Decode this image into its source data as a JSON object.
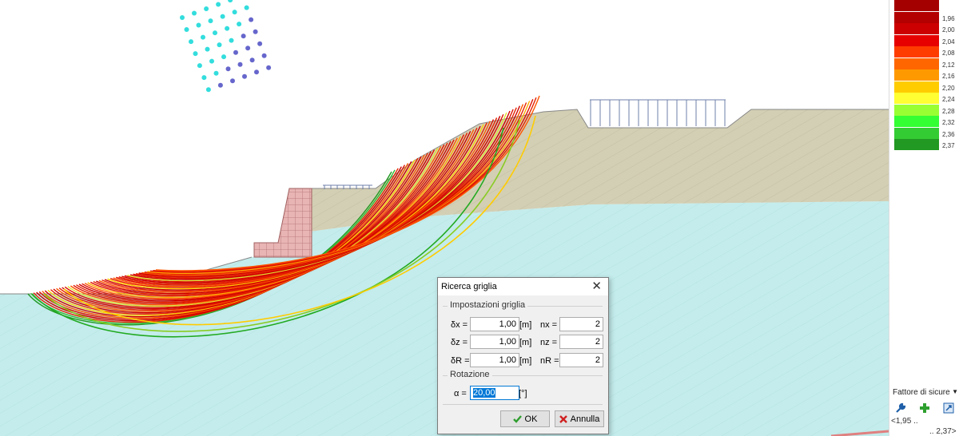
{
  "legend": {
    "title": "",
    "items": [
      {
        "label": "",
        "color": "#a50000"
      },
      {
        "label": "1,96",
        "color": "#b30000"
      },
      {
        "label": "2,00",
        "color": "#cc0000"
      },
      {
        "label": "2,04",
        "color": "#e60000"
      },
      {
        "label": "2,08",
        "color": "#ff3c00"
      },
      {
        "label": "2,12",
        "color": "#ff6600"
      },
      {
        "label": "2,16",
        "color": "#ff9900"
      },
      {
        "label": "2,20",
        "color": "#ffcc00"
      },
      {
        "label": "2,24",
        "color": "#ffff33"
      },
      {
        "label": "2,28",
        "color": "#99ff33"
      },
      {
        "label": "2,32",
        "color": "#33ff33"
      },
      {
        "label": "2,36",
        "color": "#33cc33"
      },
      {
        "label": "2,37",
        "color": "#229922"
      }
    ],
    "select_value": "Fattore di sicurezz",
    "min_label": "<1,95 ..",
    "max_label": ".. 2,37>"
  },
  "dialog": {
    "title": "Ricerca griglia",
    "group_grid": "Impostazioni griglia",
    "group_rotation": "Rotazione",
    "rows": [
      {
        "label": "δx =",
        "value": "1,00",
        "unit": "[m]",
        "label2": "nx =",
        "value2": "2"
      },
      {
        "label": "δz =",
        "value": "1,00",
        "unit": "[m]",
        "label2": "nz =",
        "value2": "2"
      },
      {
        "label": "δR =",
        "value": "1,00",
        "unit": "[m]",
        "label2": "nR =",
        "value2": "2"
      }
    ],
    "alpha_label": "α =",
    "alpha_value": "20,00",
    "alpha_unit": "[°]",
    "ok_label": "OK",
    "cancel_label": "Annulla"
  },
  "colors": {
    "terrain": "#d3cfb4",
    "water": "#c4ecec",
    "wall": "#e8b4b4",
    "dialog_bg": "#f0f0f0",
    "selection": "#0078d7"
  }
}
